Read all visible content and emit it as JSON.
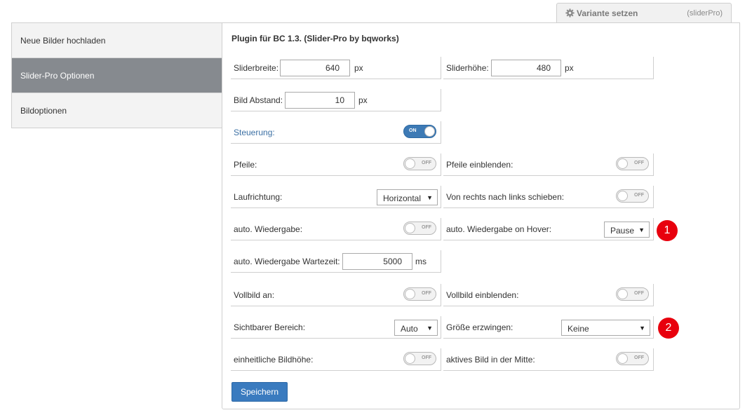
{
  "variant_tab": {
    "label": "Variante setzen",
    "code": "(sliderPro)",
    "icon": "gear-icon"
  },
  "sidebar": {
    "items": [
      {
        "label": "Neue Bilder hochladen",
        "active": false
      },
      {
        "label": "Slider-Pro Optionen",
        "active": true
      },
      {
        "label": "Bildoptionen",
        "active": false
      }
    ]
  },
  "panel": {
    "title": "Plugin für BC 1.3. (Slider-Pro by bqworks)"
  },
  "fields": {
    "slider_width": {
      "label": "Sliderbreite:",
      "value": "640",
      "unit": "px"
    },
    "slider_height": {
      "label": "Sliderhöhe:",
      "value": "480",
      "unit": "px"
    },
    "image_spacing": {
      "label": "Bild Abstand:",
      "value": "10",
      "unit": "px"
    },
    "controls": {
      "label": "Steuerung:",
      "state": "ON"
    },
    "arrows": {
      "label": "Pfeile:",
      "state": "OFF"
    },
    "arrows_fade": {
      "label": "Pfeile einblenden:",
      "state": "OFF"
    },
    "direction": {
      "label": "Laufrichtung:",
      "value": "Horizontal"
    },
    "rtl": {
      "label": "Von rechts nach links schieben:",
      "state": "OFF"
    },
    "autoplay": {
      "label": "auto. Wiedergabe:",
      "state": "OFF"
    },
    "autoplay_hover": {
      "label": "auto. Wiedergabe on Hover:",
      "value": "Pause"
    },
    "autoplay_delay": {
      "label": "auto. Wiedergabe Wartezeit:",
      "value": "5000",
      "unit": "ms"
    },
    "fullscreen": {
      "label": "Vollbild an:",
      "state": "OFF"
    },
    "fullscreen_fade": {
      "label": "Vollbild einblenden:",
      "state": "OFF"
    },
    "visible_size": {
      "label": "Sichtbarer Bereich:",
      "value": "Auto"
    },
    "force_size": {
      "label": "Größe erzwingen:",
      "value": "Keine"
    },
    "auto_height": {
      "label": "einheitliche Bildhöhe:",
      "state": "OFF"
    },
    "center_image": {
      "label": "aktives Bild in der Mitte:",
      "state": "OFF"
    }
  },
  "badges": {
    "one": "1",
    "two": "2"
  },
  "save_button": {
    "label": "Speichern"
  },
  "colors": {
    "accent": "#3a7bbf",
    "active_sidebar": "#868a8f",
    "badge": "#e8000d"
  }
}
